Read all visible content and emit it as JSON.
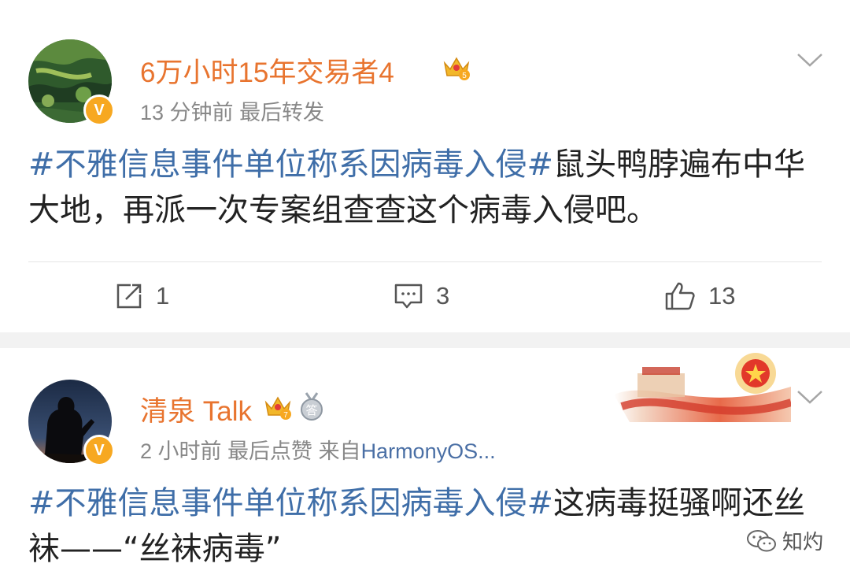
{
  "posts": [
    {
      "username": "6万小时15年交易者4",
      "crown_level": "5",
      "verified_badge": "V",
      "meta": {
        "time": "13 分钟前",
        "action": "最后转发",
        "source_prefix": "",
        "source": ""
      },
      "hashtag": "#不雅信息事件单位称系因病毒入侵#",
      "text": "鼠头鸭脖遍布中华大地，再派一次专案组查查这个病毒入侵吧。",
      "stats": {
        "repost": "1",
        "comment": "3",
        "like": "13"
      },
      "avatar_icon": "landscape-avatar"
    },
    {
      "username": "清泉 Talk",
      "crown_level": "7",
      "medal_text": "答",
      "verified_badge": "V",
      "meta": {
        "time": "2 小时前",
        "action": "最后点赞",
        "source_prefix": "来自",
        "source": "HarmonyOS..."
      },
      "hashtag": "#不雅信息事件单位称系因病毒入侵#",
      "text": "这病毒挺骚啊还丝袜——“丝袜病毒”",
      "avatar_icon": "soldier-silhouette-avatar"
    }
  ],
  "watermark": {
    "text": "知灼",
    "icon": "wechat-icon"
  },
  "colors": {
    "username": "#e8742f",
    "hashtag": "#3f6ea8",
    "body_text": "#222222",
    "meta": "#888888",
    "badge": "#f7a821",
    "separator": "#f2f2f2"
  }
}
